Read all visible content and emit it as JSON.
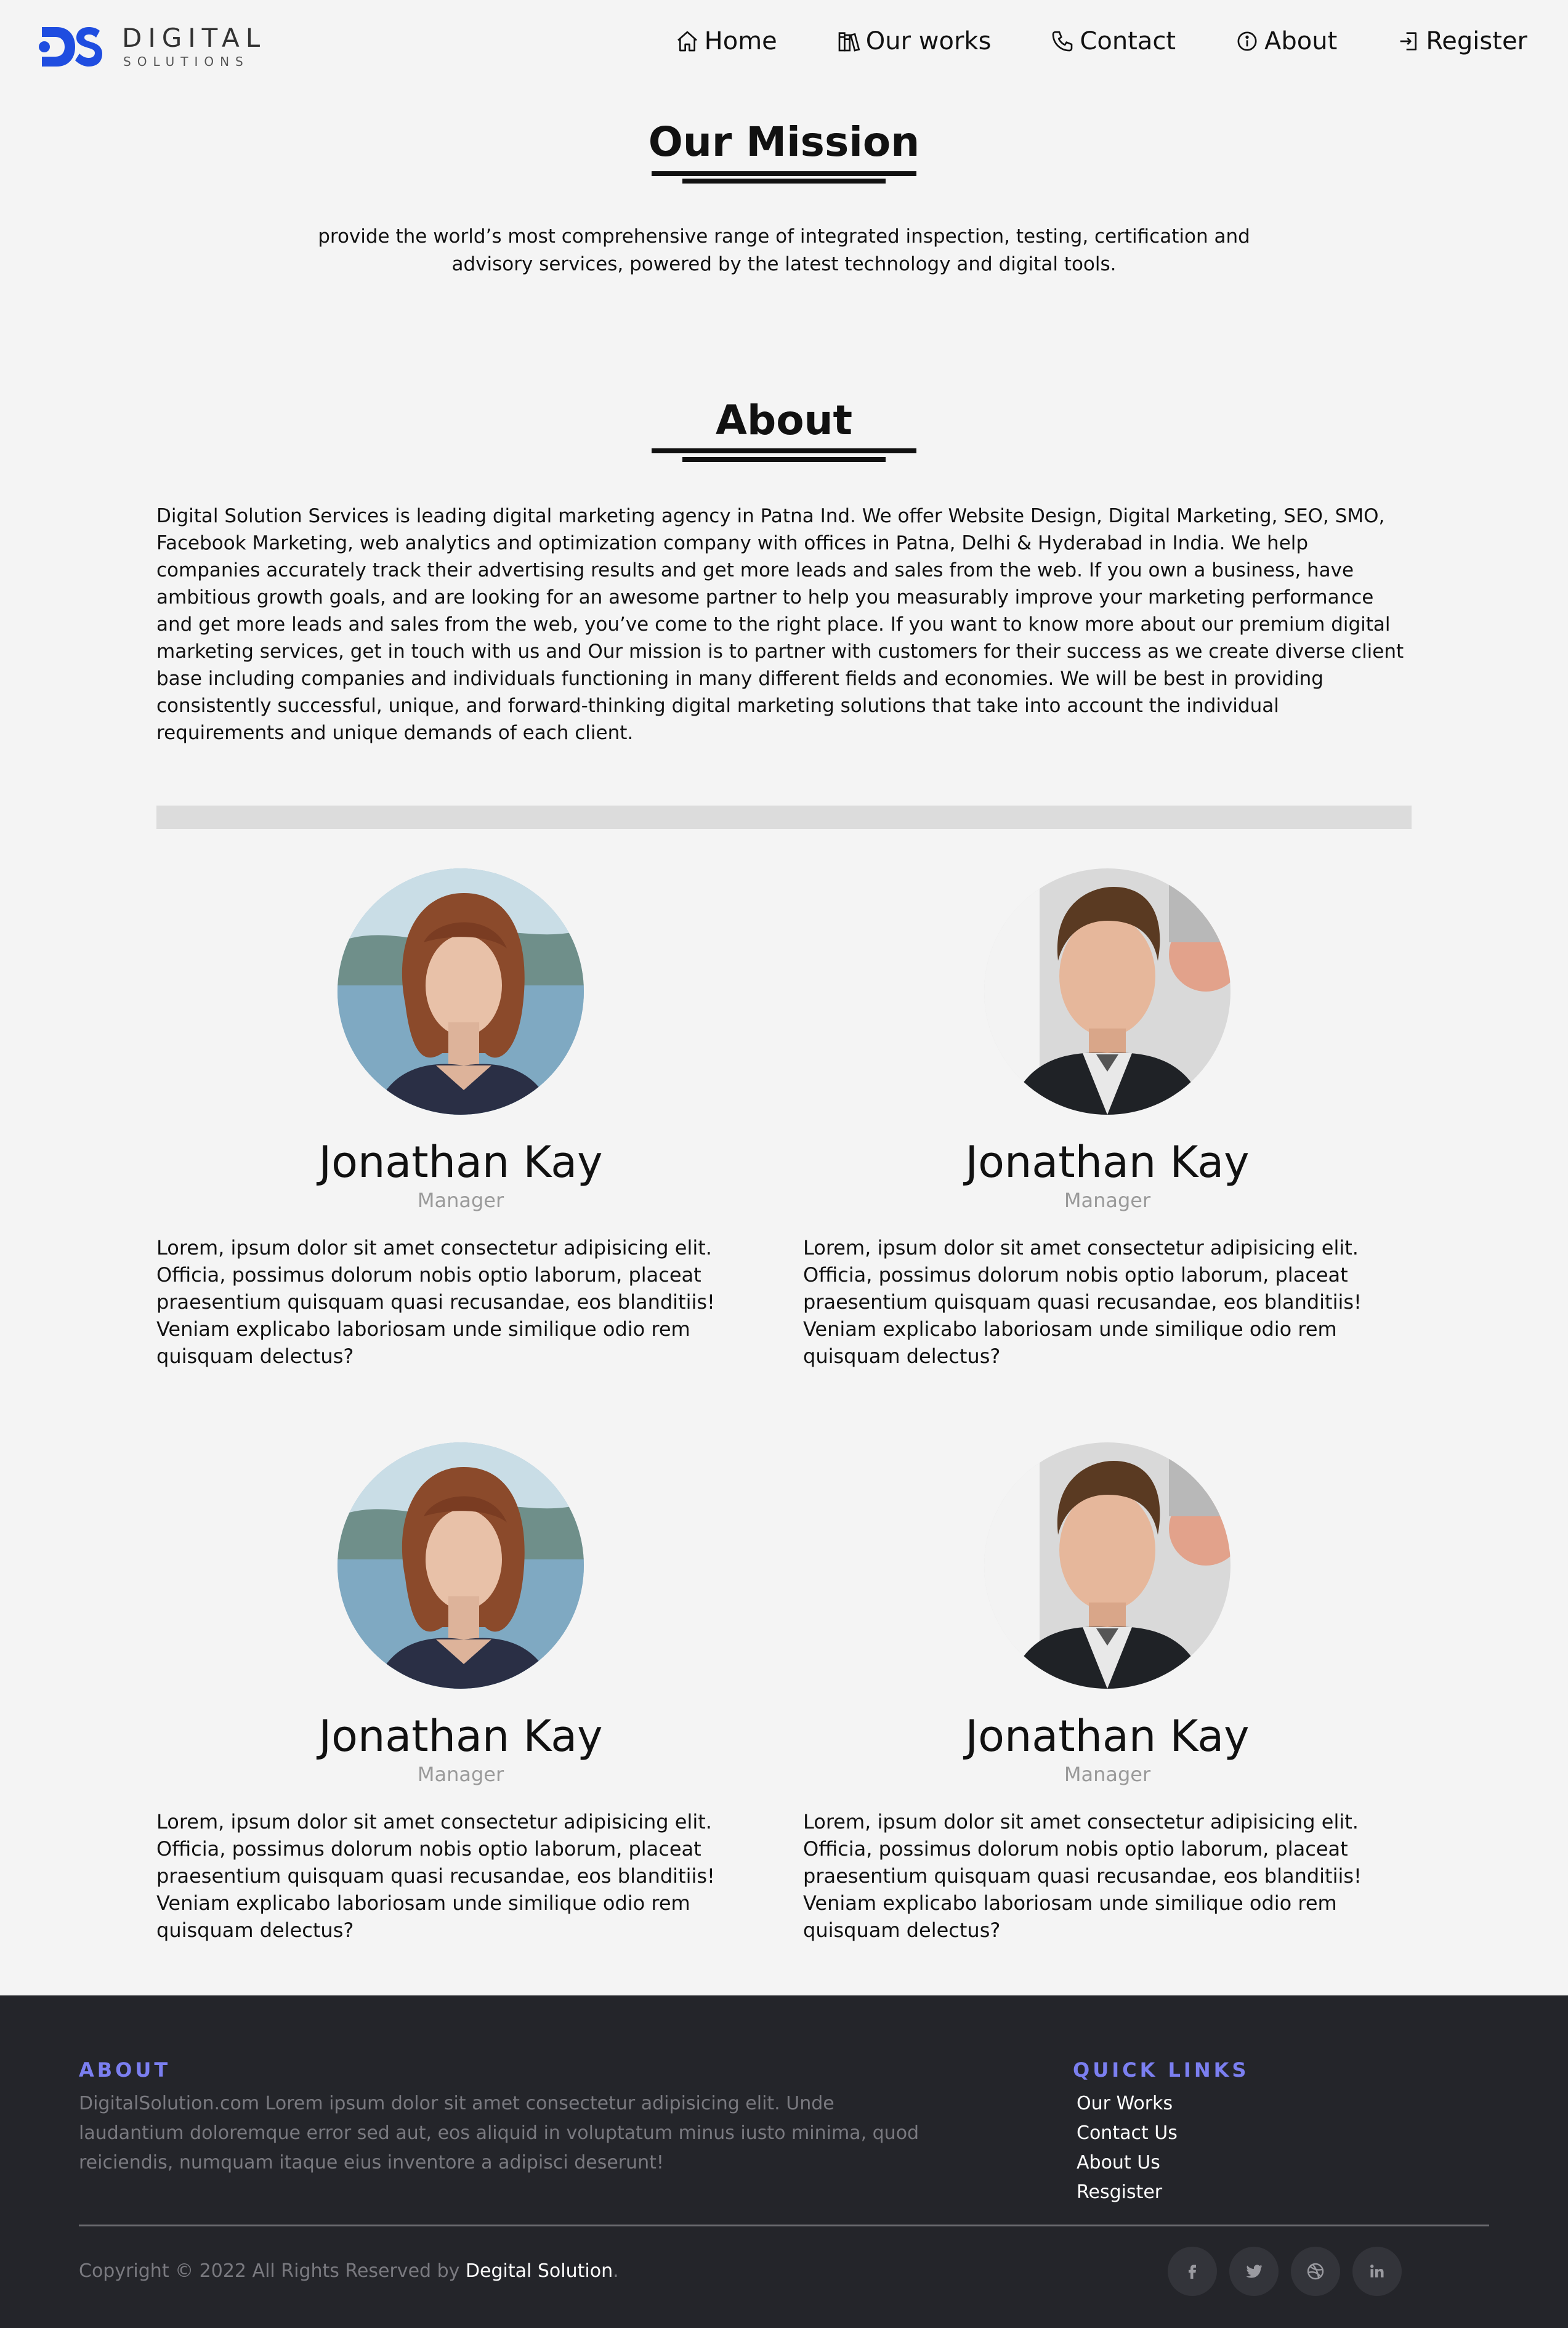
{
  "brand": {
    "title": "DIGITAL",
    "subtitle": "SOLUTIONS",
    "accent_color": "#1f4de0"
  },
  "nav": {
    "items": [
      {
        "label": "Home",
        "icon": "home-icon"
      },
      {
        "label": "Our works",
        "icon": "books-icon"
      },
      {
        "label": "Contact",
        "icon": "phone-icon"
      },
      {
        "label": "About",
        "icon": "info-icon"
      },
      {
        "label": "Register",
        "icon": "sign-in-icon"
      }
    ]
  },
  "mission": {
    "title": "Our Mission",
    "text": "provide the world’s most comprehensive range of integrated inspection, testing, certification and advisory services, powered by the latest technology and digital tools."
  },
  "about": {
    "title": "About",
    "text": "Digital Solution Services is leading digital marketing agency in Patna Ind. We offer Website Design, Digital Marketing, SEO, SMO, Facebook Marketing, web analytics and optimization company with offices in Patna, Delhi & Hyderabad in India. We help companies accurately track their advertising results and get more leads and sales from the web. If you own a business, have ambitious growth goals, and are looking for an awesome partner to help you measurably improve your marketing performance and get more leads and sales from the web, you’ve come to the right place. If you want to know more about our premium digital marketing services, get in touch with us and Our mission is to partner with customers for their success as we create diverse client base including companies and individuals functioning in many different fields and economies. We will be best in providing consistently successful, unique, and forward-thinking digital marketing solutions that take into account the individual requirements and unique demands of each client."
  },
  "team": [
    {
      "name": "Jonathan Kay",
      "role": "Manager",
      "photo": "woman-portrait",
      "bio": "Lorem, ipsum dolor sit amet consectetur adipisicing elit. Officia, possimus dolorum nobis optio laborum, placeat praesentium quisquam quasi recusandae, eos blanditiis! Veniam explicabo laboriosam unde similique odio rem quisquam delectus?"
    },
    {
      "name": "Jonathan Kay",
      "role": "Manager",
      "photo": "man-portrait",
      "bio": "Lorem, ipsum dolor sit amet consectetur adipisicing elit. Officia, possimus dolorum nobis optio laborum, placeat praesentium quisquam quasi recusandae, eos blanditiis! Veniam explicabo laboriosam unde similique odio rem quisquam delectus?"
    },
    {
      "name": "Jonathan Kay",
      "role": "Manager",
      "photo": "woman-portrait",
      "bio": "Lorem, ipsum dolor sit amet consectetur adipisicing elit. Officia, possimus dolorum nobis optio laborum, placeat praesentium quisquam quasi recusandae, eos blanditiis! Veniam explicabo laboriosam unde similique odio rem quisquam delectus?"
    },
    {
      "name": "Jonathan Kay",
      "role": "Manager",
      "photo": "man-portrait",
      "bio": "Lorem, ipsum dolor sit amet consectetur adipisicing elit. Officia, possimus dolorum nobis optio laborum, placeat praesentium quisquam quasi recusandae, eos blanditiis! Veniam explicabo laboriosam unde similique odio rem quisquam delectus?"
    }
  ],
  "footer": {
    "about_heading": "ABOUT",
    "about_text": "DigitalSolution.com Lorem ipsum dolor sit amet consectetur adipisicing elit. Unde laudantium doloremque error sed aut, eos aliquid in voluptatum minus iusto minima, quod reiciendis, numquam itaque eius inventore a adipisci deserunt!",
    "links_heading": "QUICK LINKS",
    "links": [
      "Our Works",
      "Contact Us",
      "About Us",
      "Resgister"
    ],
    "copyright_prefix": "Copyright © 2022 All Rights Reserved by ",
    "copyright_brand": "Degital Solution",
    "copyright_suffix": ".",
    "heading_color": "#7b7ff0",
    "social": [
      "facebook-icon",
      "twitter-icon",
      "dribbble-icon",
      "linkedin-icon"
    ]
  }
}
